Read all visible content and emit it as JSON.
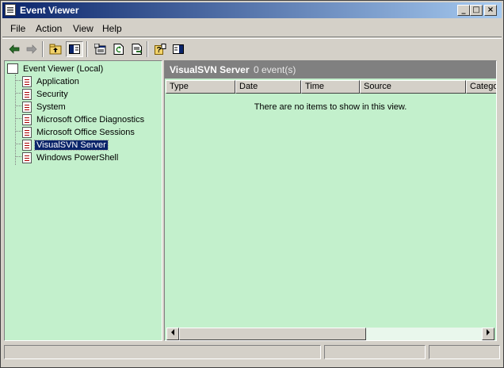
{
  "window": {
    "title": "Event Viewer",
    "icon": "event-viewer-icon"
  },
  "titlebar_buttons": {
    "minimize": "_",
    "maximize": "□",
    "close": "×"
  },
  "menu": {
    "file": "File",
    "action": "Action",
    "view": "View",
    "help": "Help"
  },
  "toolbar": [
    "back-icon",
    "forward-icon",
    "up-one-level-icon",
    "show-hide-tree-icon",
    "properties-icon",
    "refresh-icon",
    "export-list-icon",
    "help-icon",
    "show-hide-action-pane-icon"
  ],
  "tree": {
    "root": "Event Viewer (Local)",
    "items": [
      "Application",
      "Security",
      "System",
      "Microsoft Office Diagnostics",
      "Microsoft Office Sessions",
      "VisualSVN Server",
      "Windows PowerShell"
    ],
    "selected": "VisualSVN Server"
  },
  "pane": {
    "title": "VisualSVN Server",
    "count": "0 event(s)",
    "columns": [
      "Type",
      "Date",
      "Time",
      "Source",
      "Catego"
    ],
    "empty_message": "There are no items to show in this view."
  },
  "colors": {
    "content_bg": "#c3f0cc",
    "titlebar_start": "#0a246a",
    "titlebar_end": "#a6caf0",
    "selection": "#0a246a",
    "pane_header": "#808080",
    "chrome": "#d4d0c8"
  }
}
